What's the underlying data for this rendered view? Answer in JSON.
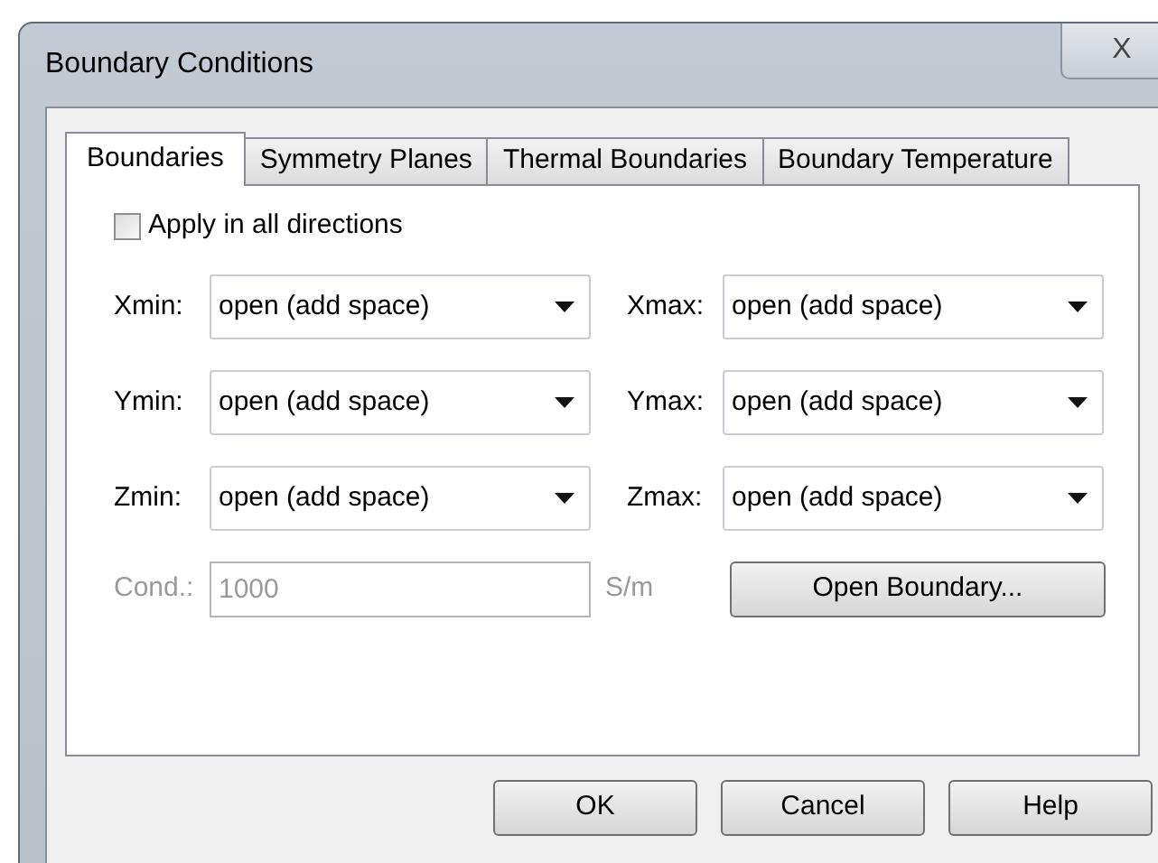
{
  "window": {
    "title": "Boundary Conditions",
    "close_label": "X"
  },
  "tabs": [
    {
      "label": "Boundaries",
      "selected": true
    },
    {
      "label": "Symmetry Planes",
      "selected": false
    },
    {
      "label": "Thermal Boundaries",
      "selected": false
    },
    {
      "label": "Boundary Temperature",
      "selected": false
    }
  ],
  "apply_all": {
    "label": "Apply in all directions",
    "checked": false
  },
  "boundaries": [
    {
      "label": "Xmin:",
      "value": "open (add space)"
    },
    {
      "label": "Xmax:",
      "value": "open (add space)"
    },
    {
      "label": "Ymin:",
      "value": "open (add space)"
    },
    {
      "label": "Ymax:",
      "value": "open (add space)"
    },
    {
      "label": "Zmin:",
      "value": "open (add space)"
    },
    {
      "label": "Zmax:",
      "value": "open (add space)"
    }
  ],
  "conductivity": {
    "label": "Cond.:",
    "value": "1000",
    "unit": "S/m",
    "disabled": true
  },
  "open_boundary_button": "Open Boundary...",
  "buttons": [
    "OK",
    "Cancel",
    "Help"
  ]
}
